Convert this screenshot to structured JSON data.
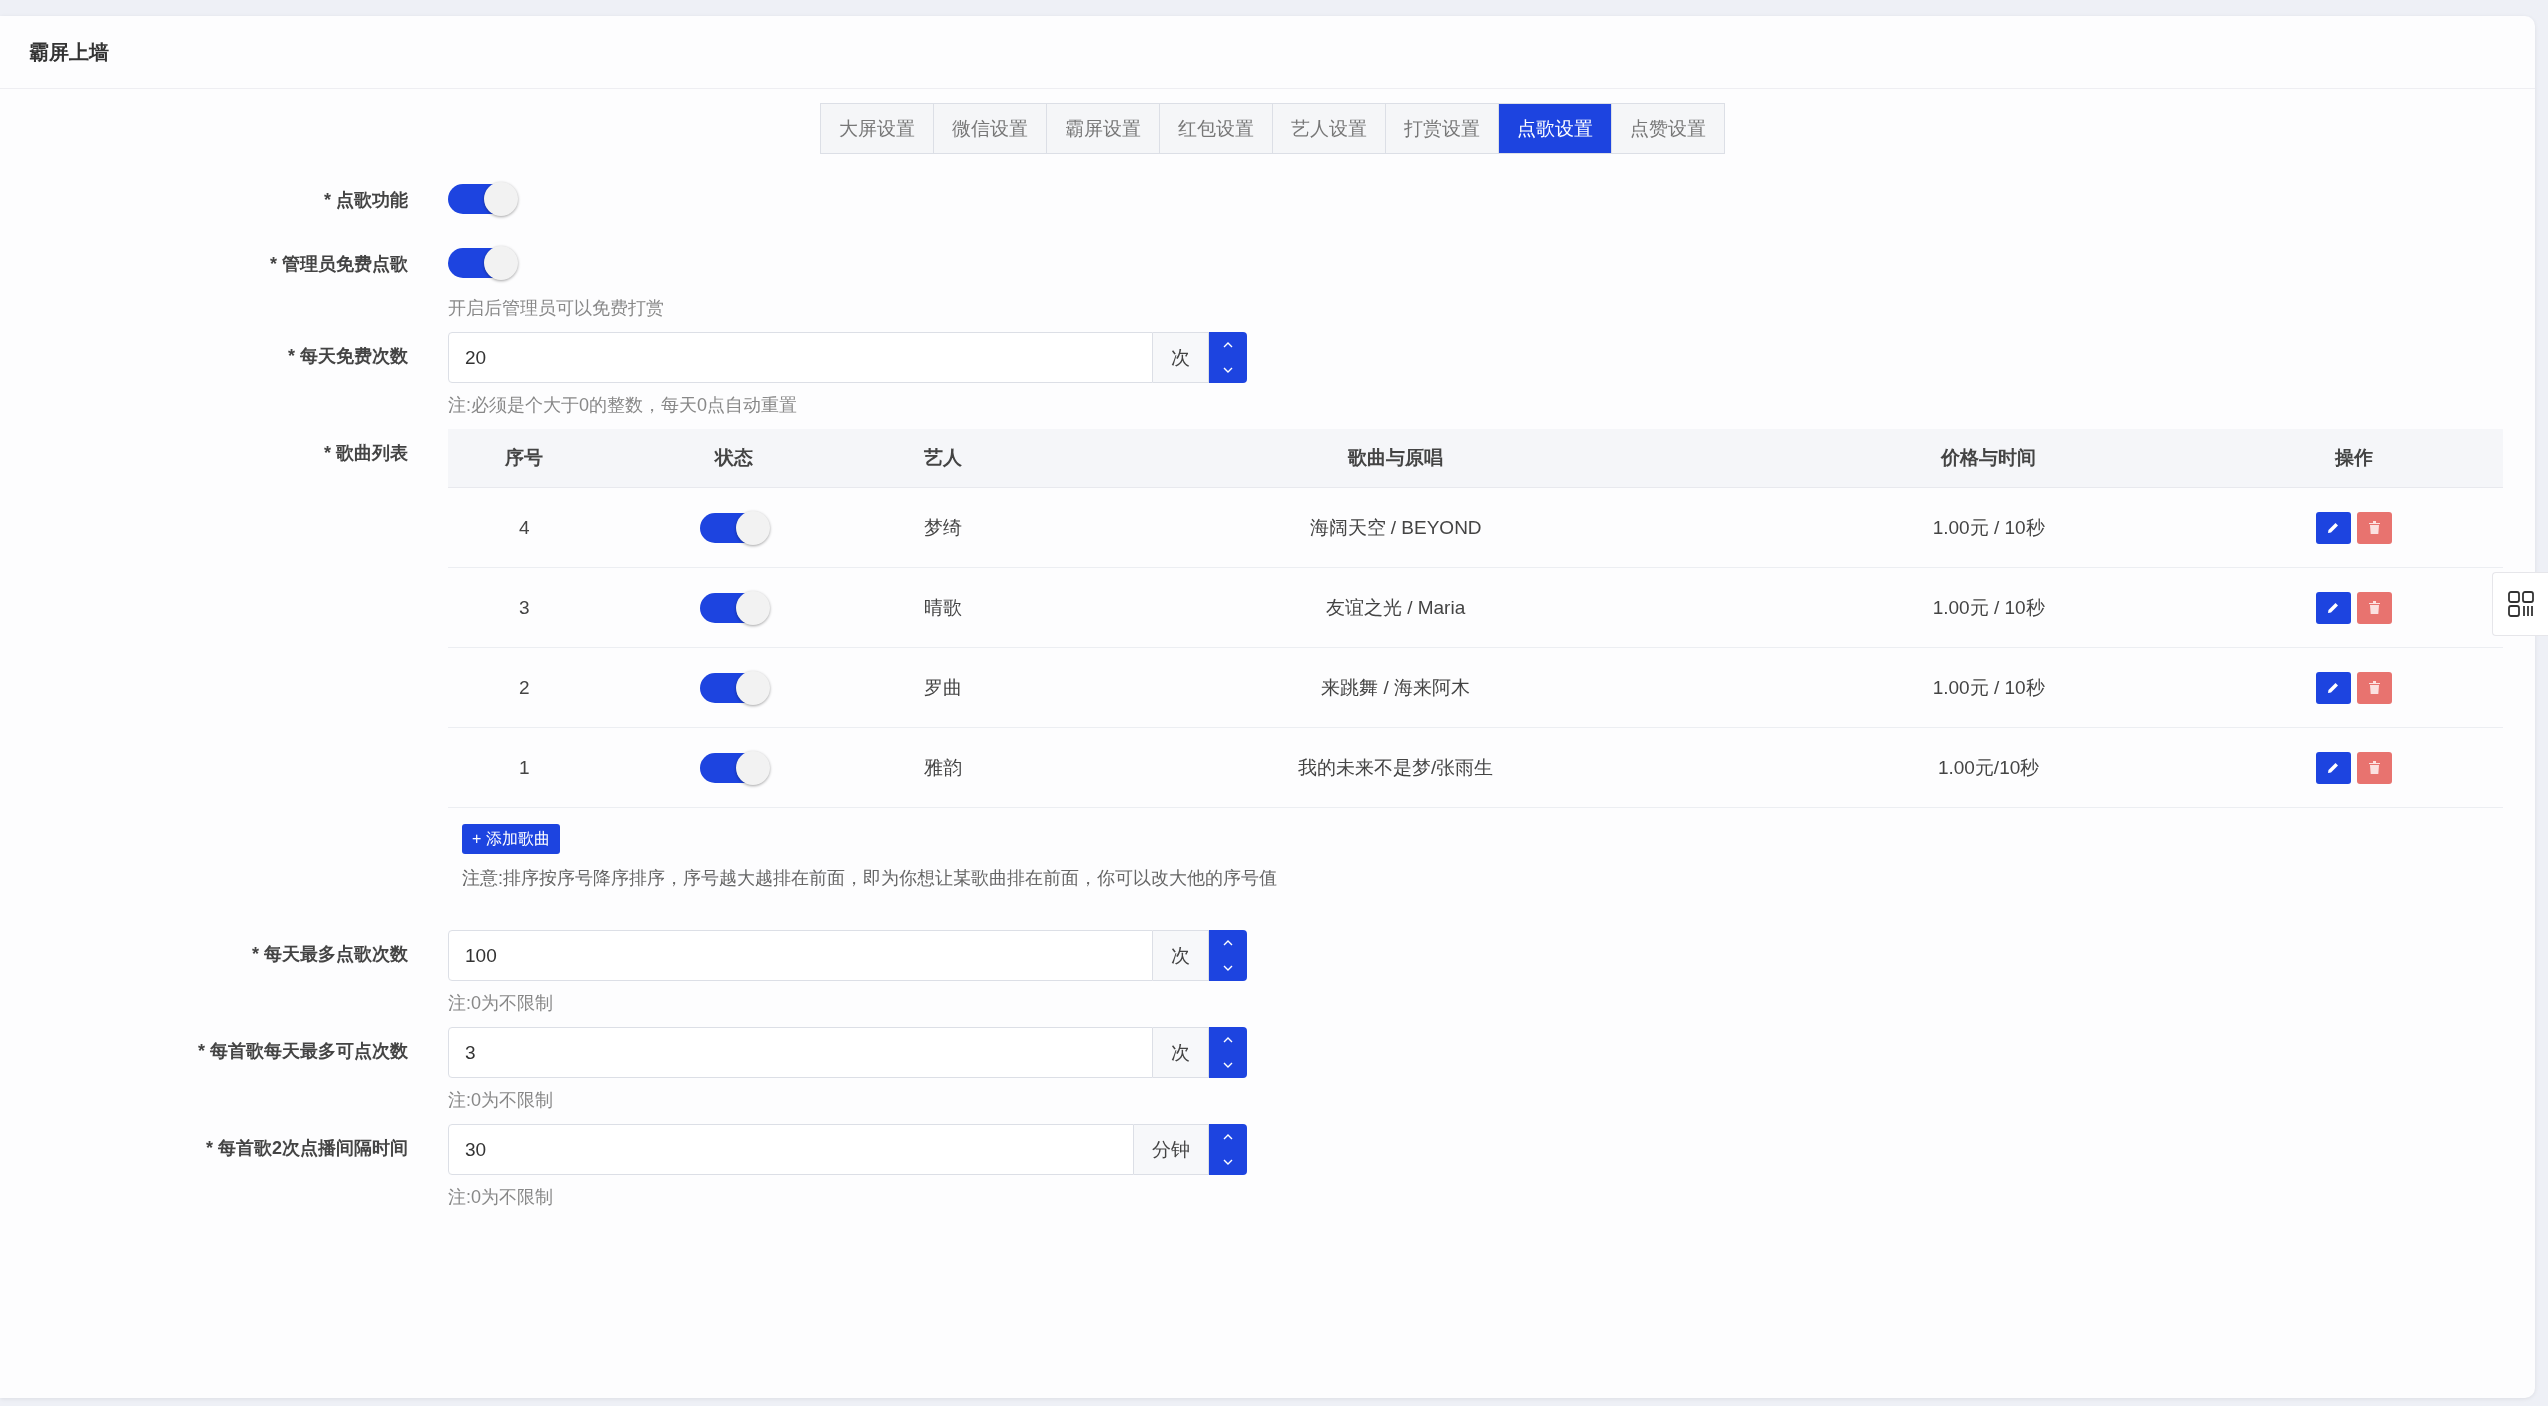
{
  "header": {
    "title": "霸屏上墙"
  },
  "tabs": [
    {
      "label": "大屏设置",
      "selected": false
    },
    {
      "label": "微信设置",
      "selected": false
    },
    {
      "label": "霸屏设置",
      "selected": false
    },
    {
      "label": "红包设置",
      "selected": false
    },
    {
      "label": "艺人设置",
      "selected": false
    },
    {
      "label": "打赏设置",
      "selected": false
    },
    {
      "label": "点歌设置",
      "selected": true
    },
    {
      "label": "点赞设置",
      "selected": false
    }
  ],
  "form": [
    {
      "kind": "switch",
      "label": "* 点歌功能",
      "on": true
    },
    {
      "kind": "switch",
      "label": "* 管理员免费点歌",
      "on": true,
      "hint": "开启后管理员可以免费打赏"
    },
    {
      "kind": "number",
      "label": "* 每天免费次数",
      "value": "20",
      "unit": "次",
      "hint": "注:必须是个大于0的整数，每天0点自动重置"
    },
    {
      "kind": "songs",
      "label": "* 歌曲列表",
      "columns": [
        "序号",
        "状态",
        "艺人",
        "歌曲与原唱",
        "价格与时间",
        "操作"
      ],
      "rows": [
        {
          "order": "4",
          "on": true,
          "artist": "梦绮",
          "song": "海阔天空 / BEYOND",
          "price": "1.00元 / 10秒"
        },
        {
          "order": "3",
          "on": true,
          "artist": "晴歌",
          "song": "友谊之光 / Maria",
          "price": "1.00元 / 10秒"
        },
        {
          "order": "2",
          "on": true,
          "artist": "罗曲",
          "song": "来跳舞 / 海来阿木",
          "price": "1.00元 / 10秒"
        },
        {
          "order": "1",
          "on": true,
          "artist": "雅韵",
          "song": "我的未来不是梦/张雨生",
          "price": "1.00元/10秒"
        }
      ],
      "add_button": "+ 添加歌曲",
      "hint": "注意:排序按序号降序排序，序号越大越排在前面，即为你想让某歌曲排在前面，你可以改大他的序号值"
    },
    {
      "kind": "number",
      "label": "* 每天最多点歌次数",
      "value": "100",
      "unit": "次",
      "hint": "注:0为不限制"
    },
    {
      "kind": "number",
      "label": "* 每首歌每天最多可点次数",
      "value": "3",
      "unit": "次",
      "hint": "注:0为不限制"
    },
    {
      "kind": "number",
      "label": "* 每首歌2次点播间隔时间",
      "value": "30",
      "unit": "分钟",
      "hint": "注:0为不限制"
    }
  ]
}
